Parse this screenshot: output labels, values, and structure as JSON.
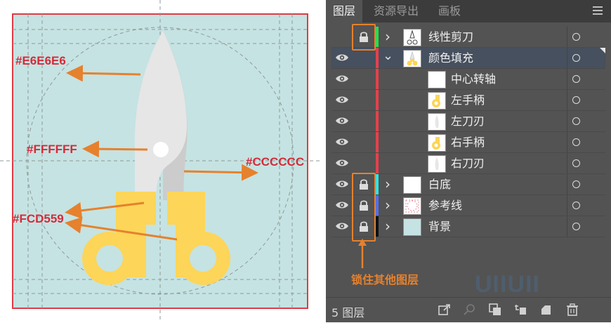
{
  "art": {
    "annotations": {
      "top_blade": "#E6E6E6",
      "pivot": "#FFFFFF",
      "shadow": "#CCCCCC",
      "handles": "#FCD559"
    },
    "colors": {
      "canvas": "#c5e3e2",
      "border": "#e03a45",
      "blade_light": "#e6e6e6",
      "blade_shadow": "#cccccc",
      "handle": "#fcd559",
      "arrow": "#e6812d",
      "note_text": "#d62a3a"
    }
  },
  "panel": {
    "tabs": [
      "图层",
      "资源导出",
      "画板"
    ],
    "active_tab": 0,
    "menu_icon": "hamburger-icon",
    "layers": [
      {
        "name": "线性剪刀",
        "visible": false,
        "locked": true,
        "expanded": false,
        "level": 0,
        "color": "#33d94a",
        "thumb": "scissors-outline"
      },
      {
        "name": "颜色填充",
        "visible": true,
        "locked": false,
        "expanded": true,
        "level": 0,
        "color": "#e5414d",
        "thumb": "scissors-color",
        "selected": true
      },
      {
        "name": "中心转轴",
        "visible": true,
        "locked": false,
        "level": 1,
        "color": "#e5414d",
        "thumb": "blank"
      },
      {
        "name": "左手柄",
        "visible": true,
        "locked": false,
        "level": 1,
        "color": "#e5414d",
        "thumb": "handle"
      },
      {
        "name": "左刀刃",
        "visible": true,
        "locked": false,
        "level": 1,
        "color": "#e5414d",
        "thumb": "blade"
      },
      {
        "name": "右手柄",
        "visible": true,
        "locked": false,
        "level": 1,
        "color": "#e5414d",
        "thumb": "handle"
      },
      {
        "name": "右刀刃",
        "visible": true,
        "locked": false,
        "level": 1,
        "color": "#e5414d",
        "thumb": "blade"
      },
      {
        "name": "白底",
        "visible": true,
        "locked": true,
        "expanded": false,
        "level": 0,
        "color": "#3ee0d8",
        "thumb": "blank"
      },
      {
        "name": "参考线",
        "visible": true,
        "locked": true,
        "expanded": false,
        "level": 0,
        "color": "#5b6ee0",
        "thumb": "guides"
      },
      {
        "name": "背景",
        "visible": true,
        "locked": true,
        "expanded": false,
        "level": 0,
        "color": "#111111",
        "thumb": "background"
      }
    ],
    "lock_note": "锁住其他图层",
    "footer": {
      "count_label": "5 图层",
      "icons": [
        "export-icon",
        "search-icon",
        "clip-mask-icon",
        "sublayer-icon",
        "new-layer-icon",
        "trash-icon"
      ]
    },
    "watermark": "UIIUII"
  }
}
